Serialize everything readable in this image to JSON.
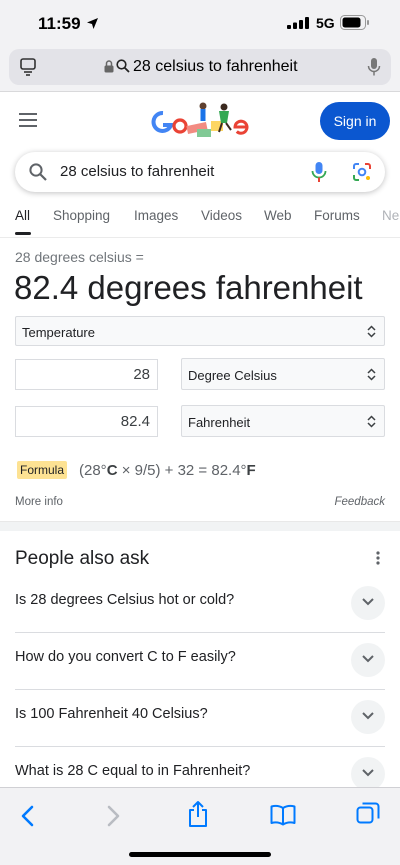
{
  "status_bar": {
    "time": "11:59",
    "network": "5G"
  },
  "browser": {
    "url_text": "28 celsius to fahrenheit"
  },
  "header": {
    "sign_in_label": "Sign in"
  },
  "search": {
    "query": "28 celsius to fahrenheit"
  },
  "tabs": [
    "All",
    "Shopping",
    "Images",
    "Videos",
    "Web",
    "Forums",
    "Ne"
  ],
  "converter": {
    "question": "28 degrees celsius =",
    "answer": "82.4 degrees fahrenheit",
    "category": "Temperature",
    "from_value": "28",
    "from_unit": "Degree Celsius",
    "to_value": "82.4",
    "to_unit": "Fahrenheit",
    "formula_label": "Formula",
    "formula_parts": [
      "(28°",
      "C",
      " × 9/5) + 32 = 82.4°",
      "F"
    ],
    "more_info": "More info",
    "feedback": "Feedback"
  },
  "people_also_ask": {
    "title": "People also ask",
    "questions": [
      "Is 28 degrees Celsius hot or cold?",
      "How do you convert C to F easily?",
      "Is 100 Fahrenheit 40 Celsius?",
      "What is 28 C equal to in Fahrenheit?"
    ]
  },
  "colors": {
    "accent_blue": "#0b57d0",
    "ios_blue": "#007aff",
    "formula_highlight": "#fde293"
  }
}
